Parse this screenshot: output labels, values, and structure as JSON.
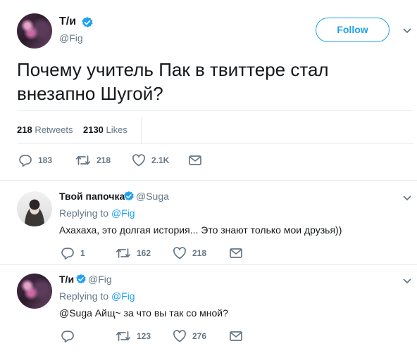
{
  "main_tweet": {
    "name": "Т/и",
    "handle": "@Fig",
    "follow_label": "Follow",
    "text": "Почему учитель Пак в твиттере стал внезапно Шугой?",
    "retweets_count": "218",
    "retweets_label": "Retweets",
    "likes_count": "2130",
    "likes_label": "Likes",
    "actions": {
      "replies": "183",
      "retweets": "218",
      "likes": "2.1K"
    }
  },
  "replies": [
    {
      "name": "Твой папочка",
      "handle": "@Suga",
      "replying_prefix": "Replying to",
      "replying_to": "@Fig",
      "text": "Ахахаха, это долгая история... Это знают только мои друзья))",
      "actions": {
        "replies": "1",
        "retweets": "162",
        "likes": "218"
      }
    },
    {
      "name": "Т/и",
      "handle": "@Fig",
      "replying_prefix": "Replying to",
      "replying_to": "@Fig",
      "text": "@Suga Айщ~ за что вы так со мной?",
      "actions": {
        "replies": "",
        "retweets": "123",
        "likes": "276"
      }
    }
  ],
  "colors": {
    "accent": "#1da1f2",
    "muted": "#657786",
    "text": "#14171a",
    "divider": "#e6ecf0"
  },
  "icons": [
    "verified-badge-icon",
    "chevron-down-icon",
    "reply-icon",
    "retweet-icon",
    "like-icon",
    "message-icon"
  ]
}
